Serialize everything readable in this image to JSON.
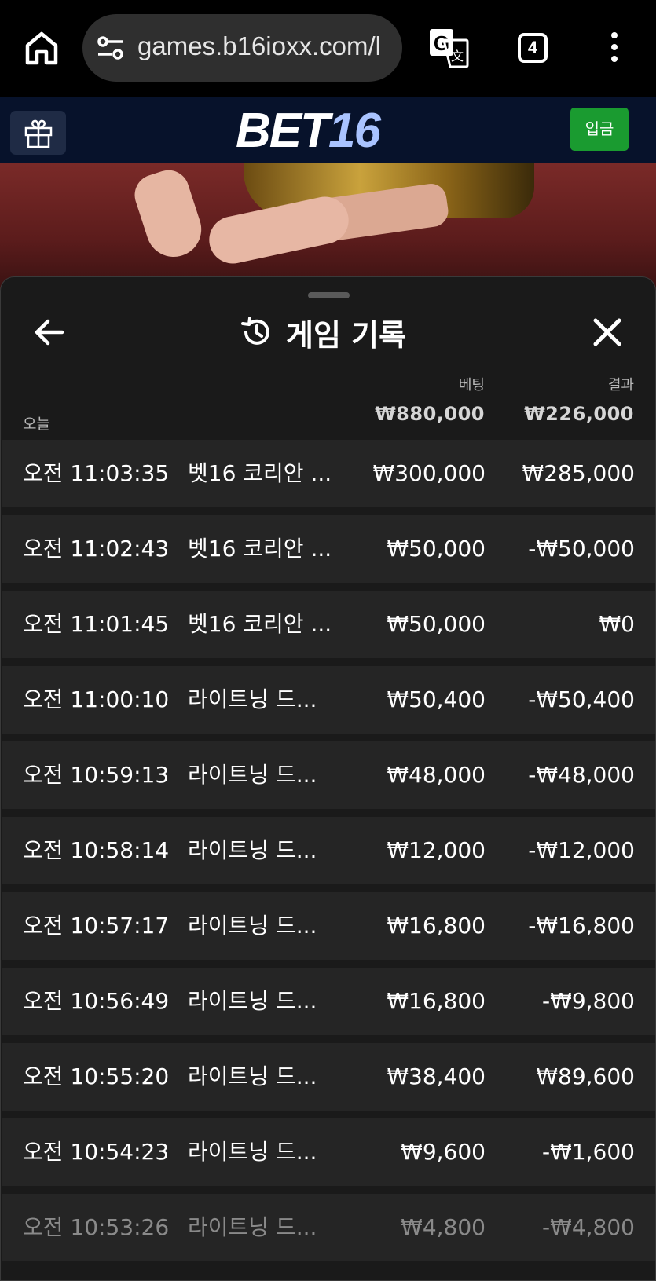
{
  "browser": {
    "url": "games.b16ioxx.com/l",
    "tab_count": "4"
  },
  "site": {
    "logo_part1": "BET",
    "logo_part2": "16",
    "deposit_label": "입금"
  },
  "panel": {
    "title": "게임 기록",
    "col_bet": "베팅",
    "col_result": "결과",
    "today_label": "오늘",
    "total_bet": "₩880,000",
    "total_result": "₩226,000"
  },
  "rows": [
    {
      "time": "오전 11:03:35",
      "game": "벳16 코리안 ...",
      "bet": "₩300,000",
      "result": "₩285,000"
    },
    {
      "time": "오전 11:02:43",
      "game": "벳16 코리안 ...",
      "bet": "₩50,000",
      "result": "-₩50,000"
    },
    {
      "time": "오전 11:01:45",
      "game": "벳16 코리안 ...",
      "bet": "₩50,000",
      "result": "₩0"
    },
    {
      "time": "오전 11:00:10",
      "game": "라이트닝 드...",
      "bet": "₩50,400",
      "result": "-₩50,400"
    },
    {
      "time": "오전 10:59:13",
      "game": "라이트닝 드...",
      "bet": "₩48,000",
      "result": "-₩48,000"
    },
    {
      "time": "오전 10:58:14",
      "game": "라이트닝 드...",
      "bet": "₩12,000",
      "result": "-₩12,000"
    },
    {
      "time": "오전 10:57:17",
      "game": "라이트닝 드...",
      "bet": "₩16,800",
      "result": "-₩16,800"
    },
    {
      "time": "오전 10:56:49",
      "game": "라이트닝 드...",
      "bet": "₩16,800",
      "result": "-₩9,800"
    },
    {
      "time": "오전 10:55:20",
      "game": "라이트닝 드...",
      "bet": "₩38,400",
      "result": "₩89,600"
    },
    {
      "time": "오전 10:54:23",
      "game": "라이트닝 드...",
      "bet": "₩9,600",
      "result": "-₩1,600"
    },
    {
      "time": "오전 10:53:26",
      "game": "라이트닝 드...",
      "bet": "₩4,800",
      "result": "-₩4,800"
    }
  ],
  "colors": {
    "deposit_green": "#1a9b30",
    "header_navy": "#07122b",
    "logo_accent": "#a9c3ff"
  }
}
